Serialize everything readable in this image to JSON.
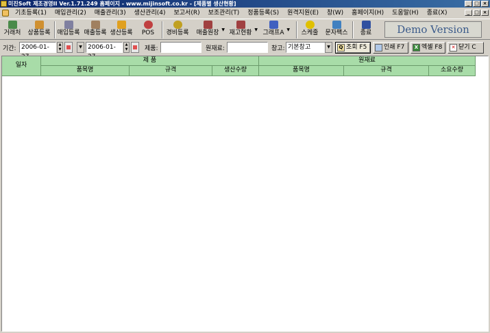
{
  "window": {
    "title": "미진Soft 제조경영II Ver.1.71.249        홈페이지 - www.mijinsoft.co.kr - [제품별 생산현황]",
    "controls": [
      "_",
      "□",
      "×"
    ]
  },
  "menu": {
    "items": [
      "기초등록(1)",
      "매입관리(2)",
      "매출관리(3)",
      "생산관리(4)",
      "보고서(R)",
      "보조관리(T)",
      "정품등록(S)",
      "원격지원(E)",
      "창(W)",
      "홈페이지(H)",
      "도움말(H)",
      "종료(X)"
    ]
  },
  "toolbar": {
    "items": [
      {
        "label": "거래처",
        "icon": "client-icon",
        "color": "#4a8a4a"
      },
      {
        "label": "상품등록",
        "icon": "product-icon",
        "color": "#d09030"
      },
      {
        "label": "매입등록",
        "icon": "purchase-icon",
        "color": "#8080a0"
      },
      {
        "label": "매출등록",
        "icon": "sales-icon",
        "color": "#a08060"
      },
      {
        "label": "생산등록",
        "icon": "production-icon",
        "color": "#e0a020"
      },
      {
        "label": "POS",
        "icon": "pos-icon",
        "color": "#c04040"
      },
      {
        "label": "경비등록",
        "icon": "expense-icon",
        "color": "#c0a020"
      },
      {
        "label": "매출원장",
        "icon": "ledger-icon",
        "color": "#a04040"
      },
      {
        "label": "재고현황",
        "icon": "inventory-icon",
        "color": "#a04040"
      },
      {
        "label": "그래프A",
        "icon": "graph-icon",
        "color": "#4060c0"
      },
      {
        "label": "스케줄",
        "icon": "schedule-icon",
        "color": "#e0c000"
      },
      {
        "label": "문자팩스",
        "icon": "sms-fax-icon",
        "color": "#4080c0"
      },
      {
        "label": "종료",
        "icon": "exit-icon",
        "color": "#3050a0"
      }
    ],
    "demo_text": "Demo Version"
  },
  "filters": {
    "period_label": "기간:",
    "date_from": "2006-01-27",
    "date_to": "2006-01-27",
    "product_label": "제품:",
    "product_value": "",
    "material_label": "원재료:",
    "material_value": "",
    "warehouse_label": "창고:",
    "warehouse_value": "기본창고"
  },
  "actions": {
    "search": "조회 F5",
    "print": "인쇄 F7",
    "excel": "엑셀 F8",
    "close": "닫기 C"
  },
  "grid": {
    "date_header": "일자",
    "product_group": "제 품",
    "material_group": "원재료",
    "product_cols": [
      "품목명",
      "규격",
      "생산수량"
    ],
    "material_cols": [
      "품목명",
      "규격",
      "소요수량"
    ],
    "header_color": "#a8dca8"
  }
}
